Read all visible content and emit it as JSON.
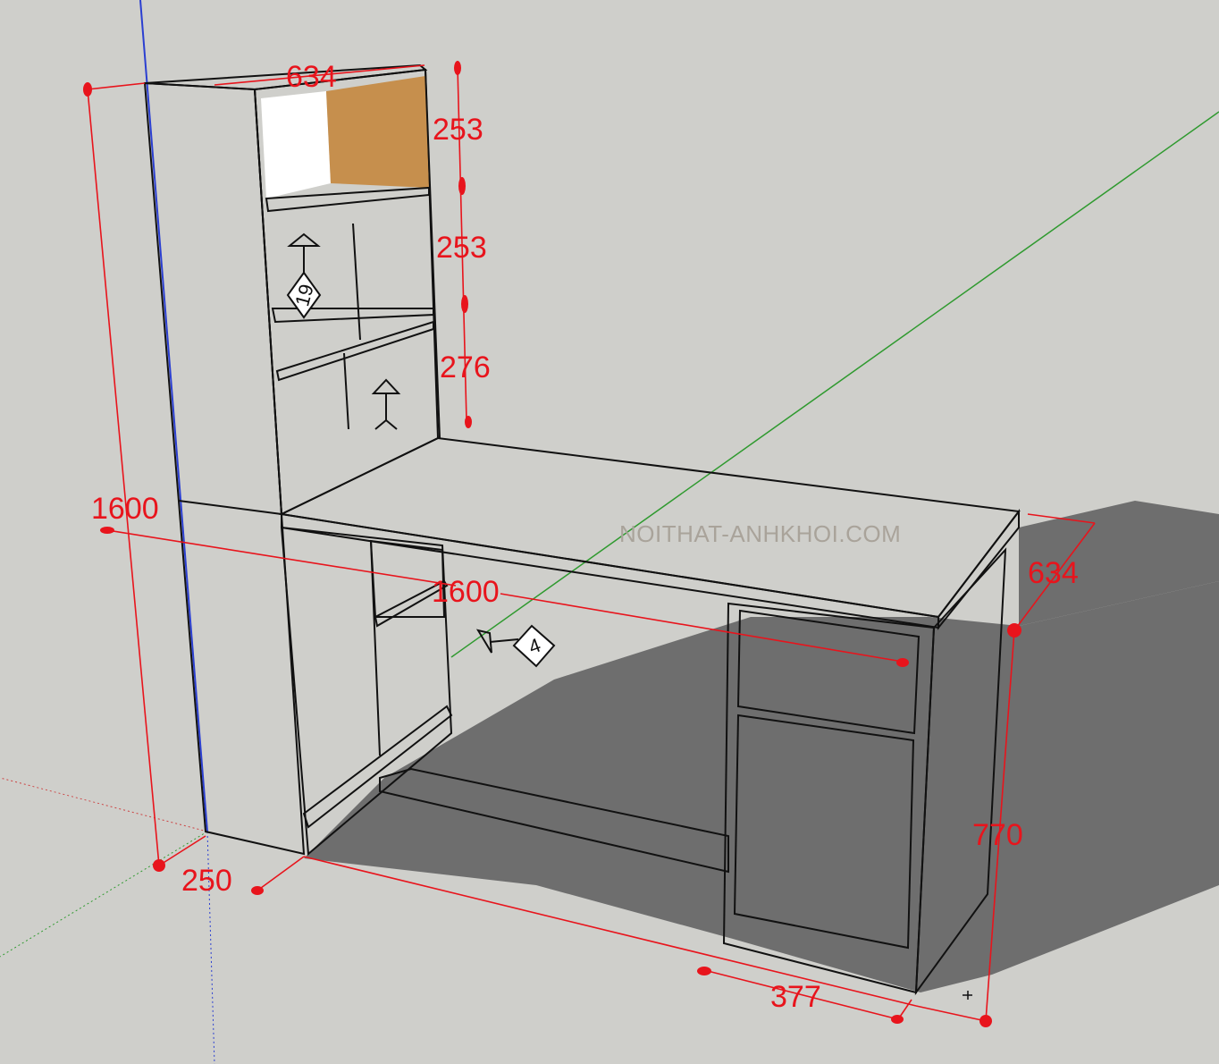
{
  "dimensions": {
    "top_depth": "634",
    "shelf_1": "253",
    "shelf_2": "253",
    "shelf_3": "276",
    "total_height": "1600",
    "desk_length": "1600",
    "desk_depth": "634",
    "desk_height": "770",
    "tower_depth": "250",
    "cabinet_width": "377"
  },
  "watermark": "NOITHAT-ANHKHOI.COM",
  "section_tags": {
    "tag_a": "19",
    "tag_b": "4"
  },
  "colors": {
    "background": "#cfcfcb",
    "wood": "#c99a5c",
    "dimension": "#e8141c",
    "shadow": "#6e6e6e",
    "axis_green": "#2f9a2f",
    "axis_blue": "#2b3fd1",
    "door": "#ffffff"
  }
}
